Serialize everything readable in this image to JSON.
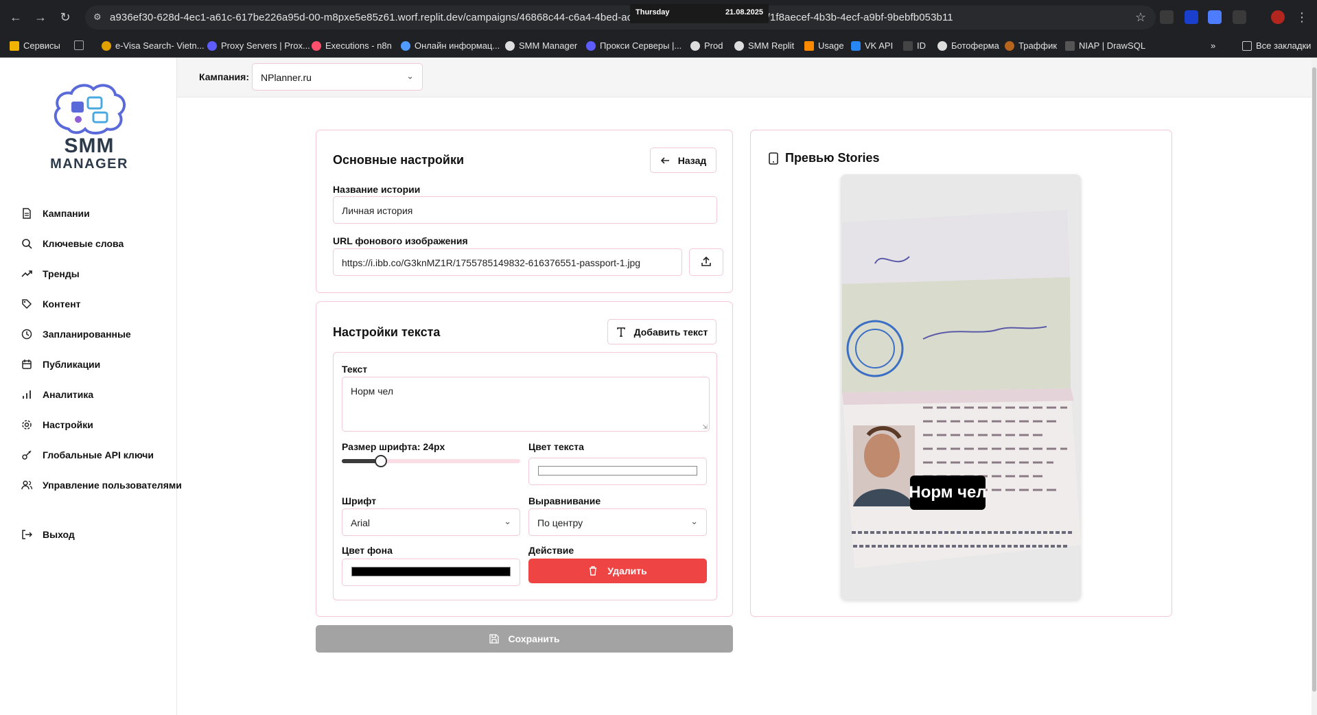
{
  "browser": {
    "url": "a936ef30-628d-4ec1-a61c-617be226a95d-00-m8pxe5e85z61.worf.replit.dev/campaigns/46868c44-c6a4-4bed-accf-9ad07bba790e/stories/edit/1f8aecef-4b3b-4ecf-a9bf-9bebfb053b11",
    "clock_day": "Thursday",
    "clock_date": "21.08.2025",
    "bookmarks": [
      "Сервисы",
      "e-Visa Search- Vietn...",
      "Proxy Servers | Prox...",
      "Executions - n8n",
      "Онлайн информац...",
      "SMM Manager",
      "Прокси Серверы |...",
      "Prod",
      "SMM Replit",
      "Usage",
      "VK API",
      "ID",
      "Ботоферма",
      "Траффик",
      "NIAP | DrawSQL"
    ],
    "more_bookmarks": "»",
    "all_bookmarks": "Все закладки"
  },
  "logo": {
    "line1": "SMM",
    "line2": "MANAGER"
  },
  "sidebar": {
    "items": [
      {
        "label": "Кампании",
        "icon": "document-icon"
      },
      {
        "label": "Ключевые слова",
        "icon": "search-icon"
      },
      {
        "label": "Тренды",
        "icon": "trending-up-icon"
      },
      {
        "label": "Контент",
        "icon": "tag-icon"
      },
      {
        "label": "Запланированные",
        "icon": "clock-icon"
      },
      {
        "label": "Публикации",
        "icon": "calendar-icon"
      },
      {
        "label": "Аналитика",
        "icon": "bar-chart-icon"
      },
      {
        "label": "Настройки",
        "icon": "gear-icon"
      },
      {
        "label": "Глобальные API ключи",
        "icon": "key-icon"
      },
      {
        "label": "Управление пользователями",
        "icon": "users-icon"
      }
    ],
    "logout": "Выход"
  },
  "topbar": {
    "campaign_label": "Кампания:",
    "campaign_value": "NPlanner.ru"
  },
  "main_settings": {
    "title": "Основные настройки",
    "back_label": "Назад",
    "name_label": "Название истории",
    "name_value": "Личная история",
    "url_label": "URL фонового изображения",
    "url_value": "https://i.ibb.co/G3knMZ1R/1755785149832-616376551-passport-1.jpg"
  },
  "text_settings": {
    "title": "Настройки текста",
    "add_text_label": "Добавить текст",
    "text_label": "Текст",
    "text_value": "Норм чел",
    "font_size_label": "Размер шрифта: 24px",
    "font_size_fraction": 0.22,
    "text_color_label": "Цвет текста",
    "text_color": "#ffffff",
    "font_label": "Шрифт",
    "font_value": "Arial",
    "align_label": "Выравнивание",
    "align_value": "По центру",
    "bg_color_label": "Цвет фона",
    "bg_color": "#000000",
    "action_label": "Действие",
    "delete_label": "Удалить"
  },
  "save_label": "Сохранить",
  "preview": {
    "title": "Превью Stories",
    "overlay_text": "Норм чел"
  },
  "colors": {
    "accent_border": "#f5c6d4",
    "danger": "#ef4444",
    "disabled": "#a3a3a3"
  }
}
